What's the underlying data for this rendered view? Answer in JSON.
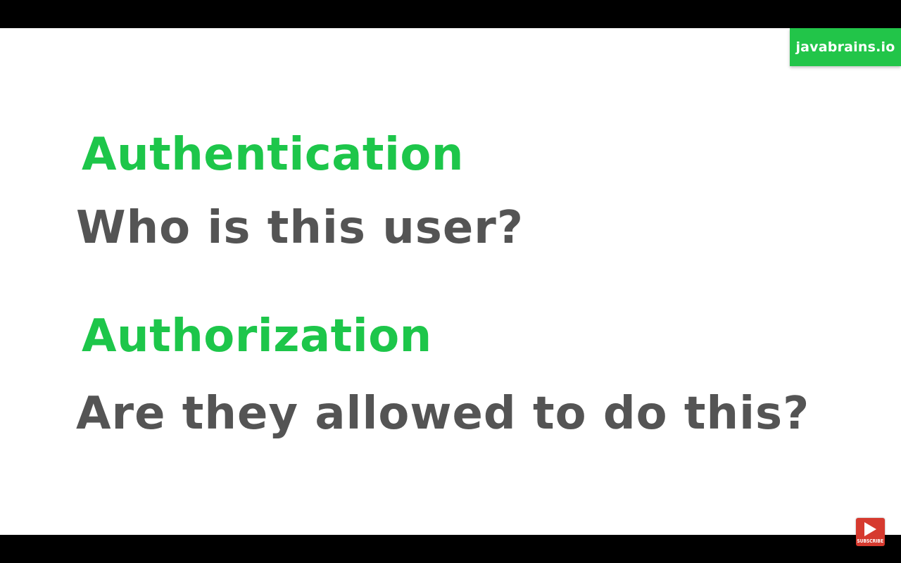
{
  "brand": {
    "label": "javabrains.io",
    "color": "#22c549"
  },
  "slide": {
    "items": [
      {
        "term": "Authentication",
        "question": "Who is this user?"
      },
      {
        "term": "Authorization",
        "question": "Are they allowed to do this?"
      }
    ],
    "term_color": "#1dc64a",
    "question_color": "#545454",
    "background": "#ffffff"
  },
  "subscribe": {
    "label": "SUBSCRIBE",
    "icon": "play-icon",
    "color": "#d63a2f"
  }
}
